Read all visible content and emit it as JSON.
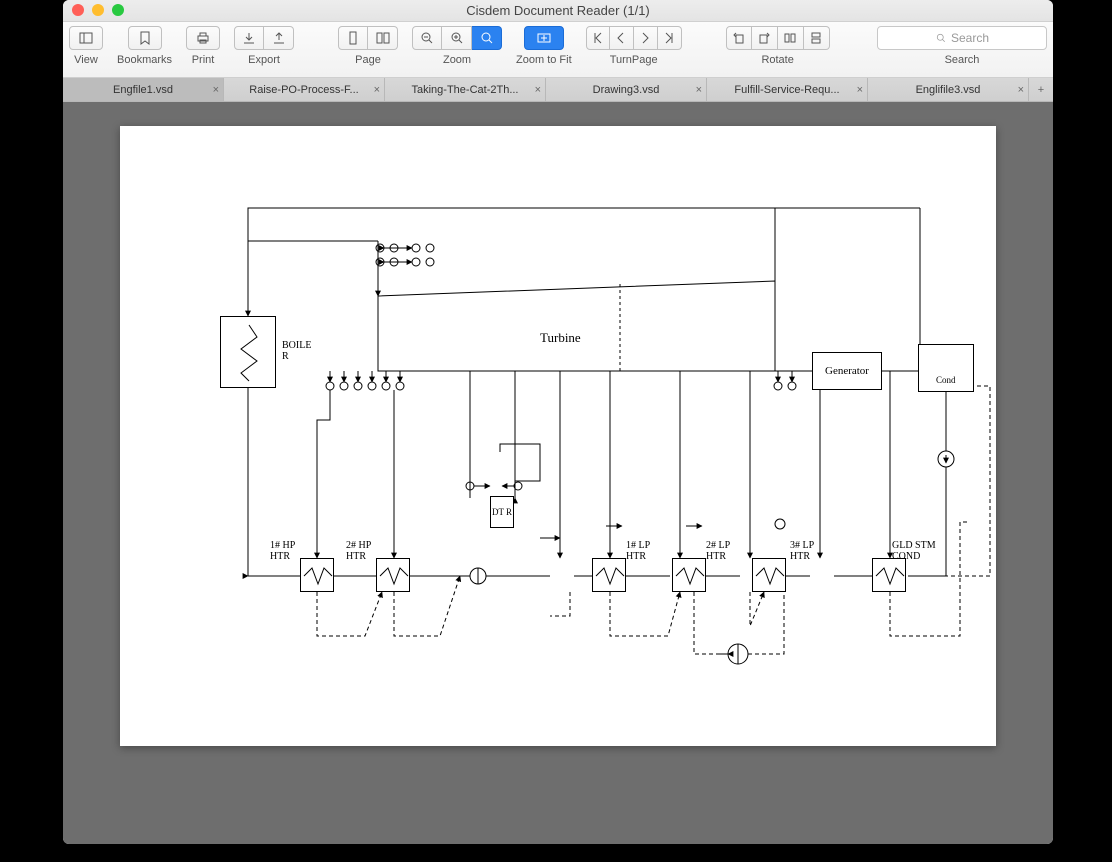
{
  "window": {
    "title": "Cisdem Document Reader (1/1)"
  },
  "toolbar": {
    "view": "View",
    "bookmarks": "Bookmarks",
    "print": "Print",
    "export": "Export",
    "page": "Page",
    "zoom": "Zoom",
    "zoom_fit": "Zoom to Fit",
    "turnpage": "TurnPage",
    "rotate": "Rotate",
    "search": "Search",
    "search_placeholder": "Search"
  },
  "tabs": [
    {
      "label": "Engfile1.vsd",
      "active": true
    },
    {
      "label": "Raise-PO-Process-F...",
      "active": false
    },
    {
      "label": "Taking-The-Cat-2Th...",
      "active": false
    },
    {
      "label": "Drawing3.vsd",
      "active": false
    },
    {
      "label": "Fulfill-Service-Requ...",
      "active": false
    },
    {
      "label": "Englifile3.vsd",
      "active": false
    }
  ],
  "diagram": {
    "boiler": "BOILE\nR",
    "turbine": "Turbine",
    "generator": "Generator",
    "cond": "Cond",
    "dtr": "DT\nR",
    "hp1": "1# HP\nHTR",
    "hp2": "2# HP\nHTR",
    "lp1": "1# LP\nHTR",
    "lp2": "2# LP\nHTR",
    "lp3": "3# LP\nHTR",
    "gld": "GLD STM\nCOND"
  }
}
